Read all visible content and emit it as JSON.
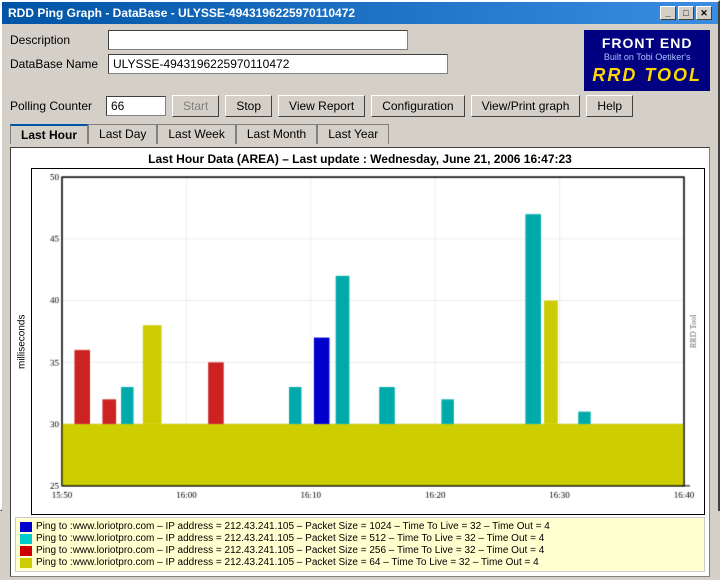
{
  "window": {
    "title": "RDD Ping Graph - DataBase - ULYSSE-4943196225970110472",
    "min_label": "_",
    "max_label": "□",
    "close_label": "✕"
  },
  "form": {
    "description_label": "Description",
    "description_value": "",
    "database_label": "DataBase Name",
    "database_value": "ULYSSE-4943196225970110472",
    "polling_label": "Polling Counter",
    "polling_value": "66"
  },
  "logo": {
    "line1": "FRONT END",
    "line2": "Built on Tobi Oetiker's",
    "line3": "RRD TOOL"
  },
  "toolbar": {
    "start_label": "Start",
    "stop_label": "Stop",
    "view_report_label": "View Report",
    "configuration_label": "Configuration",
    "view_print_label": "View/Print graph",
    "help_label": "Help"
  },
  "tabs": [
    {
      "id": "last-hour",
      "label": "Last Hour",
      "active": true
    },
    {
      "id": "last-day",
      "label": "Last Day",
      "active": false
    },
    {
      "id": "last-week",
      "label": "Last Week",
      "active": false
    },
    {
      "id": "last-month",
      "label": "Last Month",
      "active": false
    },
    {
      "id": "last-year",
      "label": "Last Year",
      "active": false
    }
  ],
  "chart": {
    "title": "Last Hour Data (AREA) – Last update : Wednesday, June 21, 2006 16:47:23",
    "y_label": "milliseconds",
    "y_min": 25,
    "y_max": 50,
    "y_ticks": [
      25,
      30,
      35,
      40,
      45,
      50
    ],
    "x_labels": [
      "15:50",
      "16:00",
      "16:10",
      "16:20",
      "16:30",
      "16:40"
    ],
    "colors": {
      "blue": "#0000cc",
      "cyan": "#00cccc",
      "red": "#cc0000",
      "yellow": "#cccc00"
    }
  },
  "legend": [
    {
      "color": "#0000cc",
      "text": "Ping to :www.loriotpro.com – IP address = 212.43.241.105 – Packet Size = 1024 – Time To Live = 32 – Time Out = 4"
    },
    {
      "color": "#00cccc",
      "text": "Ping to :www.loriotpro.com – IP address = 212.43.241.105 – Packet Size = 512 – Time To Live = 32 – Time Out = 4"
    },
    {
      "color": "#cc0000",
      "text": "Ping to :www.loriotpro.com – IP address = 212.43.241.105 – Packet Size = 256 – Time To Live = 32 – Time Out = 4"
    },
    {
      "color": "#cccc00",
      "text": "Ping to :www.loriotpro.com – IP address = 212.43.241.105 – Packet Size = 64 – Time To Live = 32 – Time Out = 4"
    }
  ]
}
